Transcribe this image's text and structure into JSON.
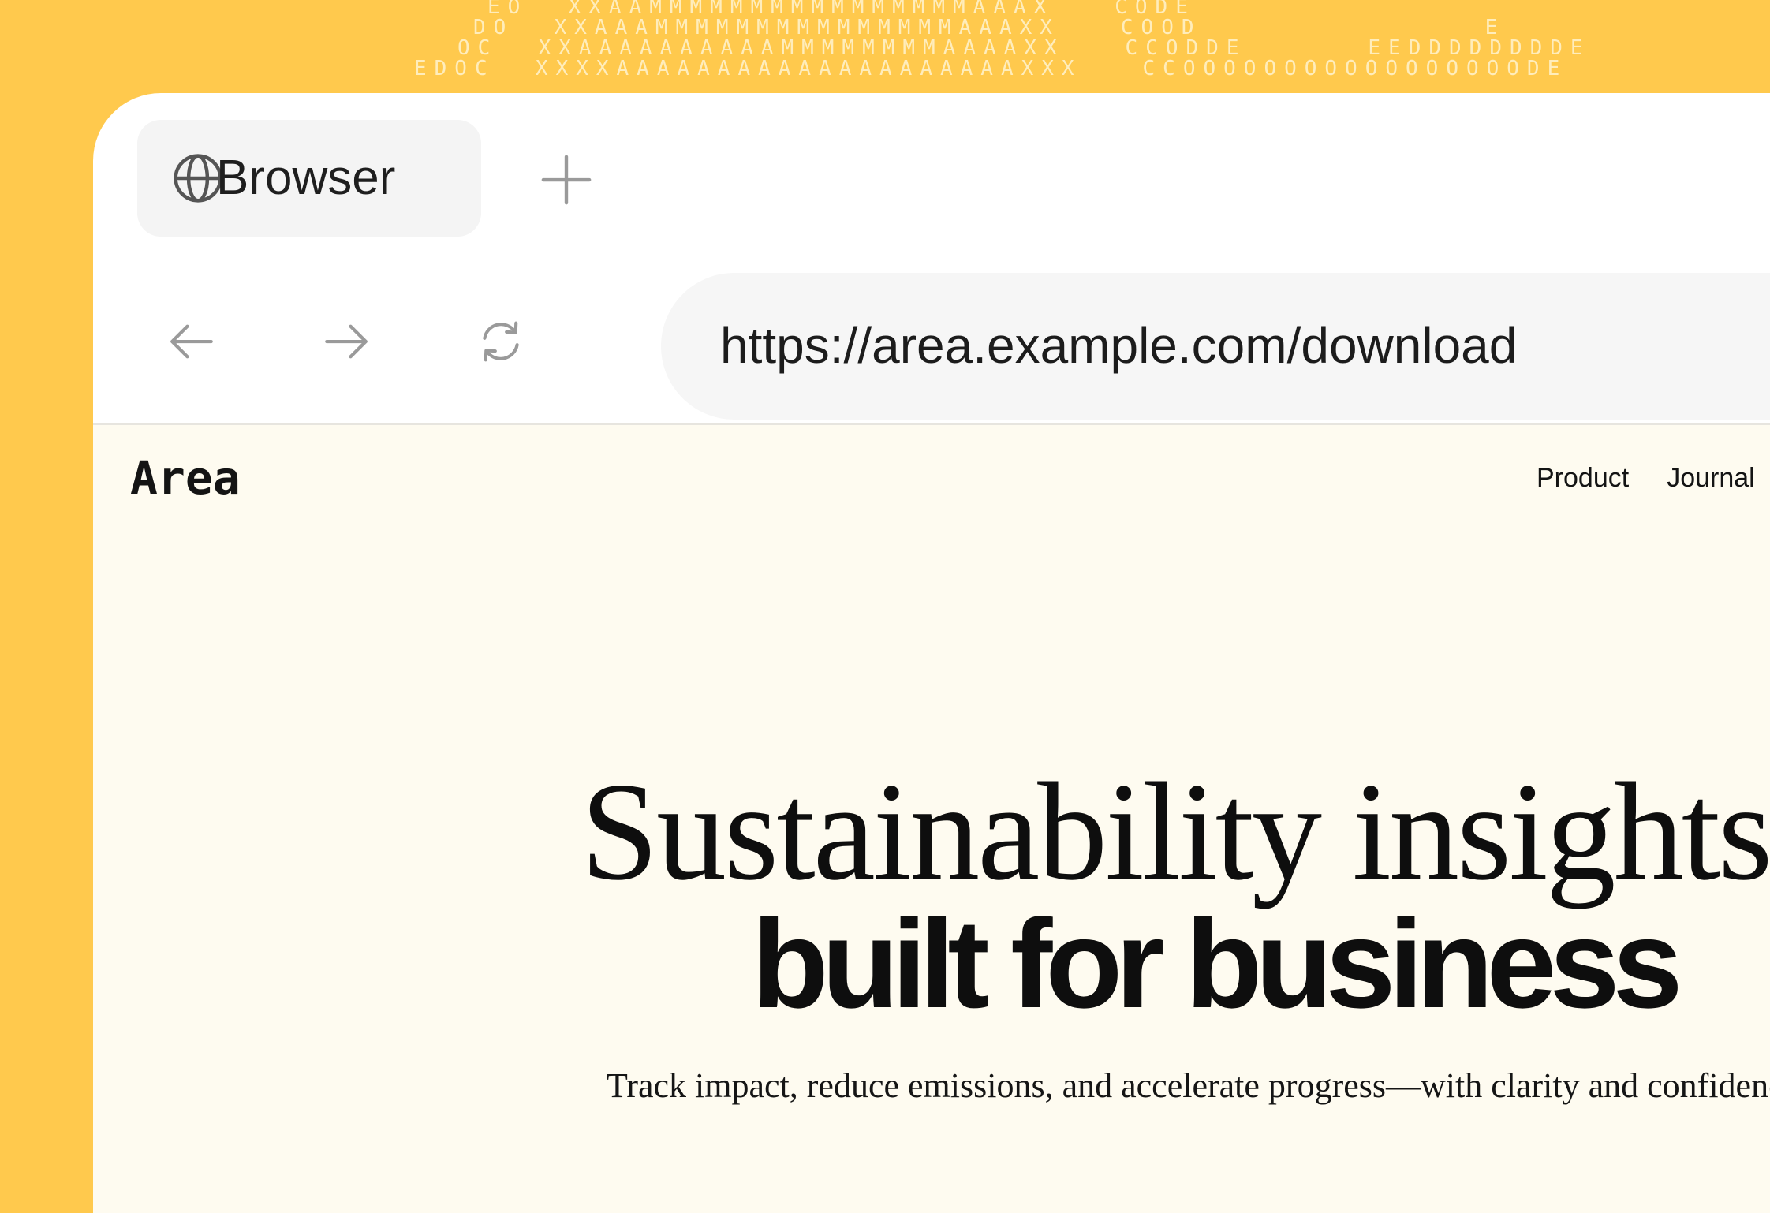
{
  "background": {
    "accent": "#ffc94d",
    "ascii_lines": [
      "EO  XXAAMMMMMMMMMMMMMMMMAAAX   CODE",
      "DO  XXAAAMMMMMMMMMMMMMMMAAAXX   COOD              E",
      "OC  XXAAAAAAAAAAMMMMMMMMAAAAXX   CCODDE      EEDDDDDDDDE",
      "EDOC  XXXXAAAAAAAAAAAAAAAAAAAAXXX   CCOOOOOOOOOOOOOOOOODE"
    ]
  },
  "browser": {
    "tab": {
      "label": "Browser",
      "icon": "globe-icon"
    },
    "new_tab_icon": "plus-icon",
    "nav": {
      "back_icon": "arrow-left-icon",
      "forward_icon": "arrow-right-icon",
      "reload_icon": "reload-icon"
    },
    "url": "https://area.example.com/download"
  },
  "site": {
    "logo": "Area",
    "nav": [
      "Product",
      "Journal"
    ],
    "hero": {
      "title_line1": "Sustainability insights",
      "title_line2": "built for business",
      "subtitle": "Track impact, reduce emissions, and accelerate progress—with clarity and confidence."
    }
  }
}
